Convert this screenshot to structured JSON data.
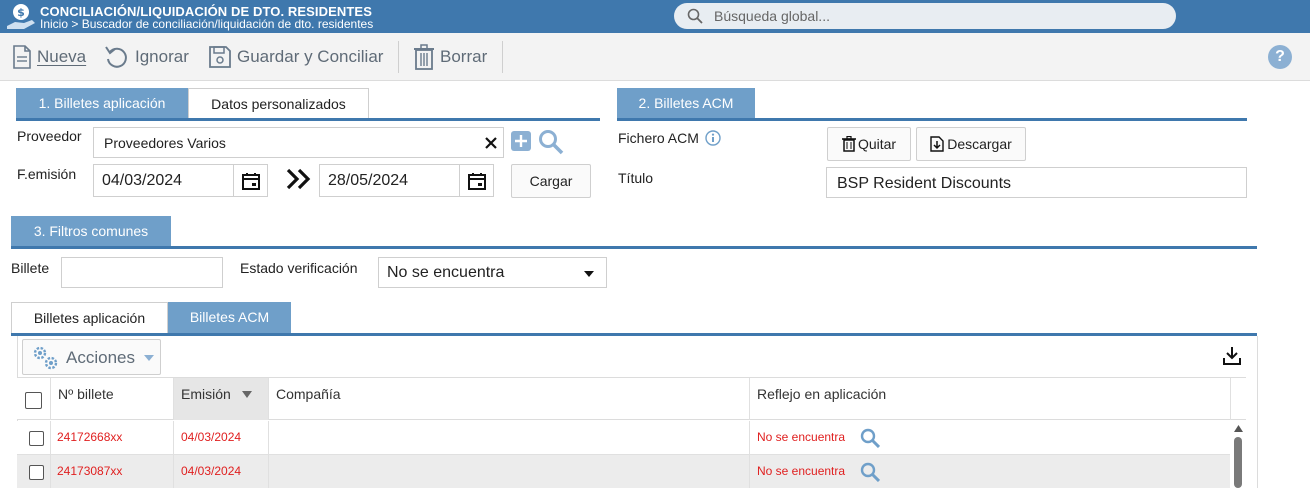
{
  "header": {
    "title": "CONCILIACIÓN/LIQUIDACIÓN DE DTO. RESIDENTES",
    "breadcrumb": "Inicio > Buscador de conciliación/liquidación de dto. residentes",
    "search_placeholder": "Búsqueda global..."
  },
  "toolbar": {
    "new_label": "Nueva",
    "ignore_label": "Ignorar",
    "save_label": "Guardar y Conciliar",
    "delete_label": "Borrar",
    "help_label": "?"
  },
  "section1": {
    "tabs": [
      "1. Billetes aplicación",
      "Datos personalizados"
    ],
    "provider_label": "Proveedor",
    "provider_value": "Proveedores Varios",
    "date_label": "F.emisión",
    "date_from": "04/03/2024",
    "date_to": "28/05/2024",
    "load_button": "Cargar"
  },
  "section2": {
    "tab": "2. Billetes ACM",
    "file_label": "Fichero ACM",
    "remove_button": "Quitar",
    "download_button": "Descargar",
    "title_label": "Título",
    "title_value": "BSP Resident Discounts"
  },
  "section3": {
    "tab": "3. Filtros comunes",
    "ticket_label": "Billete",
    "ticket_value": "",
    "status_label": "Estado verificación",
    "status_value": "No se encuentra"
  },
  "results": {
    "tabs": [
      "Billetes aplicación",
      "Billetes ACM"
    ],
    "actions_label": "Acciones",
    "columns": [
      "Nº billete",
      "Emisión",
      "Compañía",
      "Reflejo en aplicación"
    ],
    "rows": [
      {
        "ticket": "24172668xx",
        "date": "04/03/2024",
        "company": "",
        "reflection": "No se encuentra"
      },
      {
        "ticket": "24173087xx",
        "date": "04/03/2024",
        "company": "",
        "reflection": "No se encuentra"
      }
    ]
  },
  "colors": {
    "header": "#3f78ad",
    "tab_active": "#6f9fc9",
    "error": "#e02020"
  }
}
